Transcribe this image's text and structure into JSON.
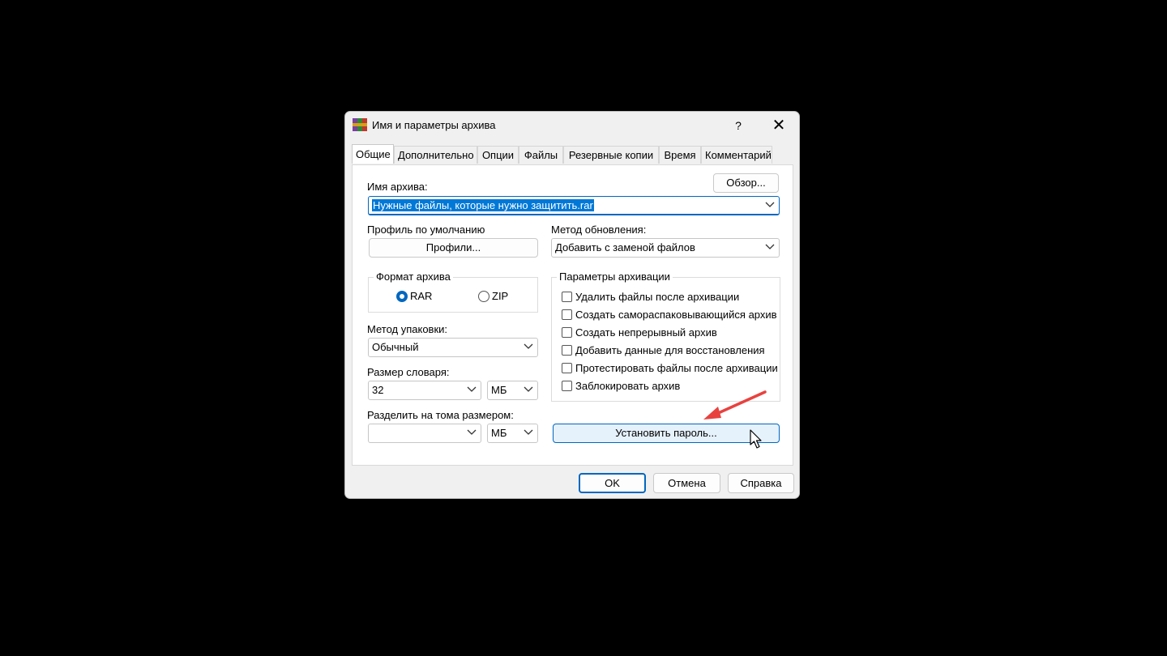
{
  "dialog": {
    "title": "Имя и параметры архива",
    "help": "?",
    "close": "✕"
  },
  "tabs": [
    "Общие",
    "Дополнительно",
    "Опции",
    "Файлы",
    "Резервные копии",
    "Время",
    "Комментарий"
  ],
  "general": {
    "browse_label": "Обзор...",
    "archive_name_label": "Имя архива:",
    "archive_name_value": "Нужные файлы, которые нужно защитить.rar",
    "default_profile_label": "Профиль по умолчанию",
    "profiles_button": "Профили...",
    "update_method_label": "Метод обновления:",
    "update_method_value": "Добавить с заменой файлов",
    "format_group_label": "Формат архива",
    "format_rar": "RAR",
    "format_zip": "ZIP",
    "format_selected": "RAR",
    "compression_label": "Метод упаковки:",
    "compression_value": "Обычный",
    "dict_label": "Размер словаря:",
    "dict_value": "32",
    "dict_unit": "МБ",
    "split_label": "Разделить на тома размером:",
    "split_value": "",
    "split_unit": "МБ",
    "options_group_label": "Параметры архивации",
    "options": [
      {
        "label": "Удалить файлы после архивации",
        "checked": false
      },
      {
        "label": "Создать самораспаковывающийся архив",
        "checked": false
      },
      {
        "label": "Создать непрерывный архив",
        "checked": false
      },
      {
        "label": "Добавить данные для восстановления",
        "checked": false
      },
      {
        "label": "Протестировать файлы после архивации",
        "checked": false
      },
      {
        "label": "Заблокировать архив",
        "checked": false
      }
    ],
    "set_password_button": "Установить пароль..."
  },
  "footer": {
    "ok": "OK",
    "cancel": "Отмена",
    "help": "Справка"
  },
  "colors": {
    "accent": "#0067c0",
    "arrow": "#e8423f",
    "highlight_button": "#e5f1fb"
  }
}
